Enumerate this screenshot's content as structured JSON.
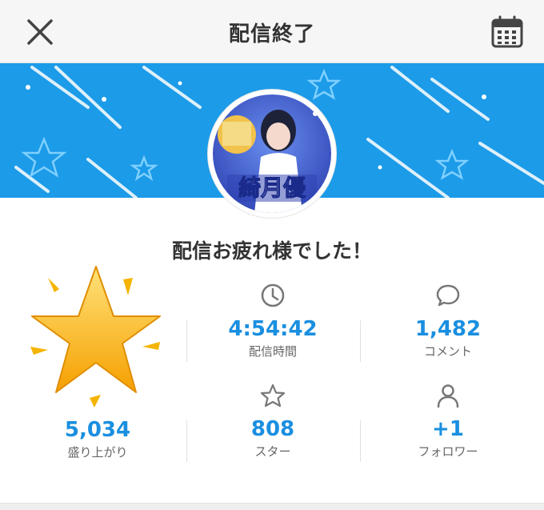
{
  "header": {
    "title": "配信終了"
  },
  "banner": {
    "color": "#1c9be8",
    "avatar_text": "綺月優"
  },
  "main": {
    "message": "配信お疲れ様でした！"
  },
  "stats": {
    "duration": {
      "value": "4:54:42",
      "label": "配信時間"
    },
    "comments": {
      "value": "1,482",
      "label": "コメント"
    },
    "excitement": {
      "value": "5,034",
      "label": "盛り上がり"
    },
    "stars": {
      "value": "808",
      "label": "スター"
    },
    "followers": {
      "value": "+1",
      "label": "フォロワー"
    }
  },
  "colors": {
    "accent": "#1a8fe0",
    "icon_gray": "#777777"
  }
}
